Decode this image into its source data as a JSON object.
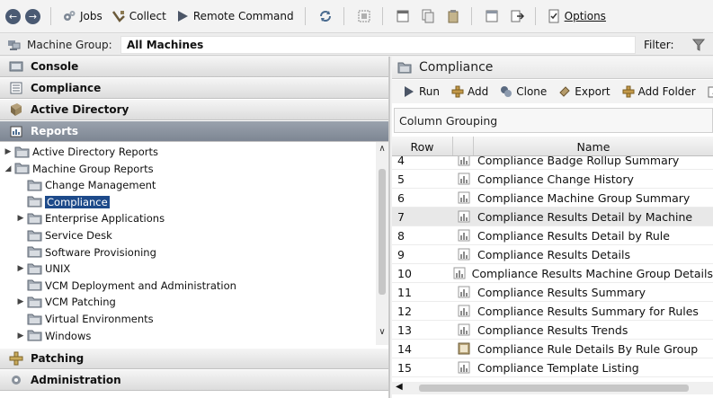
{
  "toolbar": {
    "jobs": "Jobs",
    "collect": "Collect",
    "remote_command": "Remote Command",
    "options": "Options"
  },
  "filterbar": {
    "machine_group_label": "Machine Group:",
    "machine_group_value": "All Machines",
    "filter_label": "Filter:"
  },
  "nav": {
    "console": "Console",
    "compliance": "Compliance",
    "active_directory": "Active Directory",
    "reports": "Reports",
    "patching": "Patching",
    "administration": "Administration"
  },
  "tree": [
    {
      "label": "Active Directory Reports",
      "arrow": "▶",
      "level": 0
    },
    {
      "label": "Machine Group Reports",
      "arrow": "◢",
      "level": 0
    },
    {
      "label": "Change Management",
      "arrow": "",
      "level": 1
    },
    {
      "label": "Compliance",
      "arrow": "",
      "level": 1,
      "selected": true
    },
    {
      "label": "Enterprise Applications",
      "arrow": "▶",
      "level": 1
    },
    {
      "label": "Service Desk",
      "arrow": "",
      "level": 1
    },
    {
      "label": "Software Provisioning",
      "arrow": "",
      "level": 1
    },
    {
      "label": "UNIX",
      "arrow": "▶",
      "level": 1
    },
    {
      "label": "VCM Deployment and Administration",
      "arrow": "",
      "level": 1
    },
    {
      "label": "VCM Patching",
      "arrow": "▶",
      "level": 1
    },
    {
      "label": "Virtual Environments",
      "arrow": "",
      "level": 1
    },
    {
      "label": "Windows",
      "arrow": "▶",
      "level": 1
    }
  ],
  "right": {
    "title": "Compliance",
    "actions": {
      "run": "Run",
      "add": "Add",
      "clone": "Clone",
      "export": "Export",
      "add_folder": "Add Folder"
    },
    "grouping": "Column Grouping",
    "columns": {
      "row": "Row",
      "name": "Name"
    },
    "rows": [
      {
        "row": "4",
        "name": "Compliance Badge Rollup Summary"
      },
      {
        "row": "5",
        "name": "Compliance Change History"
      },
      {
        "row": "6",
        "name": "Compliance Machine Group Summary"
      },
      {
        "row": "7",
        "name": "Compliance Results Detail by Machine",
        "highlight": true
      },
      {
        "row": "8",
        "name": "Compliance Results Detail by Rule"
      },
      {
        "row": "9",
        "name": "Compliance Results Details"
      },
      {
        "row": "10",
        "name": "Compliance Results Machine Group Details"
      },
      {
        "row": "11",
        "name": "Compliance Results Summary"
      },
      {
        "row": "12",
        "name": "Compliance Results Summary for Rules"
      },
      {
        "row": "13",
        "name": "Compliance Results Trends"
      },
      {
        "row": "14",
        "name": "Compliance Rule Details By Rule Group",
        "alt_icon": true
      },
      {
        "row": "15",
        "name": "Compliance Template Listing"
      }
    ]
  }
}
